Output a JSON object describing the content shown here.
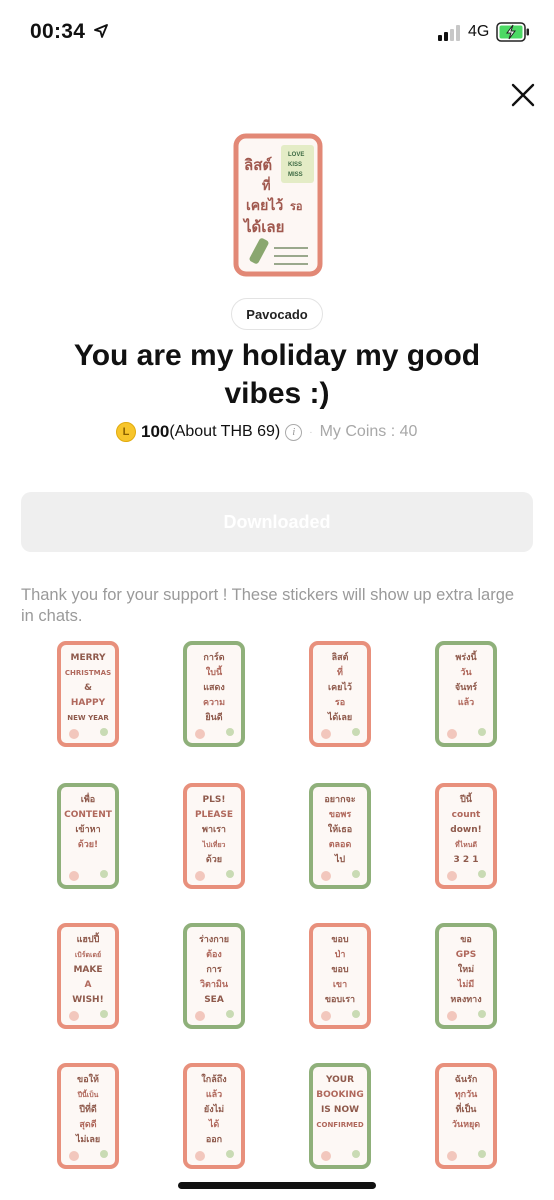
{
  "status_bar": {
    "time": "00:34",
    "network": "4G",
    "location_icon": "location-arrow-icon",
    "signal_icon": "cellular-signal-icon",
    "battery_icon": "battery-charging-icon",
    "battery_color": "#4cd964"
  },
  "close_icon": "close-icon",
  "sticker_pack": {
    "author": "Pavocado",
    "title": "You are my holiday my good vibes :)",
    "hero_sticker": {
      "lines": [
        "ลิสต์",
        "ที่",
        "เคยไว้",
        "รอ",
        "ได้เลย"
      ],
      "tags": [
        "LOVE",
        "KISS",
        "MISS"
      ]
    },
    "price": {
      "coin_letter": "L",
      "amount": "100",
      "about": "(About THB 69)",
      "separator": "·",
      "my_coins": "My Coins : 40"
    },
    "download_button": "Downloaded",
    "note": "Thank you for your support ! These stickers will show up extra large in chats."
  },
  "stickers": [
    {
      "frame": "#e8907c",
      "lines": [
        "MERRY",
        "CHRISTMAS",
        "&",
        "HAPPY",
        "NEW YEAR"
      ]
    },
    {
      "frame": "#8fb07a",
      "lines": [
        "การ์ด",
        "ใบนี้",
        "แสดง",
        "ความ",
        "ยินดี"
      ]
    },
    {
      "frame": "#e8907c",
      "lines": [
        "ลิสต์",
        "ที่",
        "เคยไว้",
        "รอ",
        "ได้เลย"
      ]
    },
    {
      "frame": "#8fb07a",
      "lines": [
        "พร่งนี้",
        "วัน",
        "จันทร์",
        "แล้ว"
      ]
    },
    {
      "frame": "#8fb07a",
      "lines": [
        "เพื่อ",
        "CONTENT",
        "เข้าหา",
        "ด้วย!"
      ]
    },
    {
      "frame": "#e8907c",
      "lines": [
        "PLS!",
        "PLEASE",
        "พาเรา",
        "ไปเที่ยว",
        "ด้วย"
      ]
    },
    {
      "frame": "#8fb07a",
      "lines": [
        "อยากจะ",
        "ขอพร",
        "ให้เธอ",
        "ตลอด",
        "ไป"
      ]
    },
    {
      "frame": "#e8907c",
      "lines": [
        "ปีนี้",
        "count",
        "down!",
        "ที่ไหนดี",
        "3 2 1"
      ]
    },
    {
      "frame": "#e8907c",
      "lines": [
        "แฮปปี้",
        "เบิร์ดเดย์",
        "MAKE",
        "A",
        "WISH!"
      ]
    },
    {
      "frame": "#8fb07a",
      "lines": [
        "ร่างกาย",
        "ต้อง",
        "การ",
        "วิตามิน",
        "SEA"
      ]
    },
    {
      "frame": "#e8907c",
      "lines": [
        "ขอบ",
        "ป่า",
        "ขอบ",
        "เขา",
        "ขอบเรา"
      ]
    },
    {
      "frame": "#8fb07a",
      "lines": [
        "ขอ",
        "GPS",
        "ใหม่",
        "ไม่มี",
        "หลงทาง"
      ]
    },
    {
      "frame": "#e8907c",
      "lines": [
        "ขอให้",
        "ปีนี้เป็น",
        "ปีที่ดี",
        "สุดดี",
        "ไม่เลย"
      ]
    },
    {
      "frame": "#e8907c",
      "lines": [
        "ใกล้ถึง",
        "แล้ว",
        "ยังไม่",
        "ได้",
        "ออก"
      ]
    },
    {
      "frame": "#8fb07a",
      "lines": [
        "YOUR",
        "BOOKING",
        "IS NOW",
        "CONFIRMED"
      ]
    },
    {
      "frame": "#e8907c",
      "lines": [
        "ฉันรัก",
        "ทุกวัน",
        "ที่เป็น",
        "วันหยุด"
      ]
    }
  ]
}
